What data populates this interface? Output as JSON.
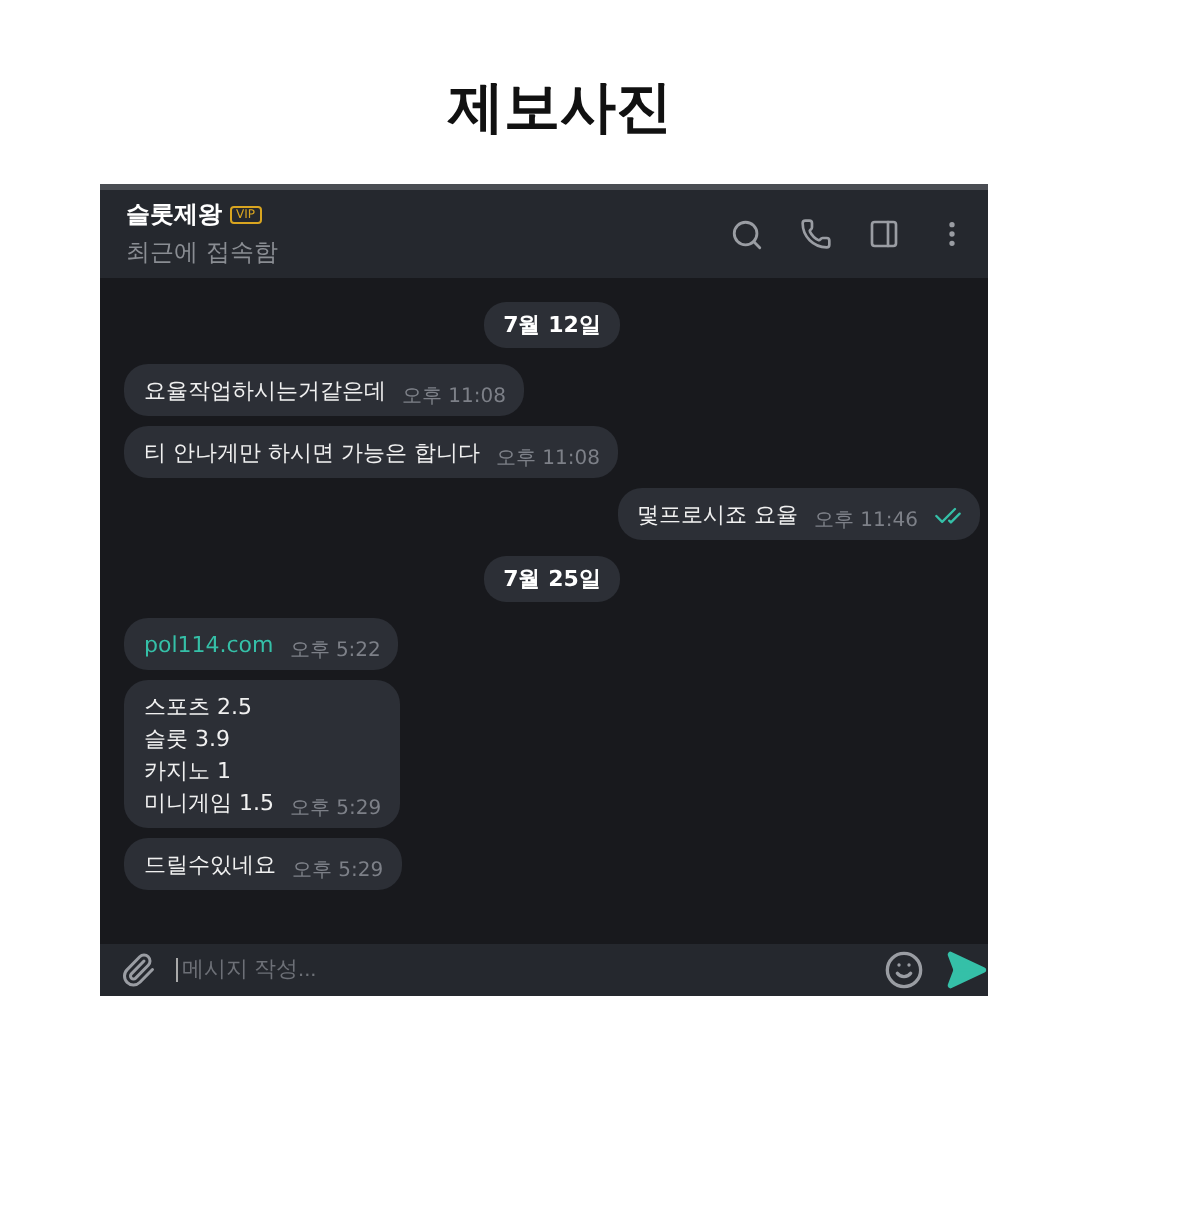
{
  "page_title": "제보사진",
  "chat": {
    "name": "슬롯제왕",
    "badge": "VIP",
    "status": "최근에 접속함",
    "messages": [
      {
        "kind": "date",
        "text": "7월 12일"
      },
      {
        "kind": "incoming",
        "lines": [
          "요율작업하시는거같은데"
        ],
        "time": "오후 11:08",
        "link": false
      },
      {
        "kind": "incoming",
        "lines": [
          "티 안나게만 하시면 가능은 합니다"
        ],
        "time": "오후 11:08",
        "link": false
      },
      {
        "kind": "outgoing",
        "lines": [
          "몇프로시죠 요율"
        ],
        "time": "오후 11:46",
        "read": true
      },
      {
        "kind": "date",
        "text": "7월 25일"
      },
      {
        "kind": "incoming",
        "lines": [
          "pol114.com"
        ],
        "time": "오후 5:22",
        "link": true
      },
      {
        "kind": "incoming",
        "lines": [
          "스포츠 2.5",
          "슬롯 3.9",
          "카지노 1",
          "미니게임 1.5"
        ],
        "time": "오후 5:29",
        "link": false
      },
      {
        "kind": "incoming",
        "lines": [
          "드릴수있네요"
        ],
        "time": "오후 5:29",
        "link": false
      }
    ],
    "composer": {
      "placeholder": "메시지 작성..."
    }
  }
}
